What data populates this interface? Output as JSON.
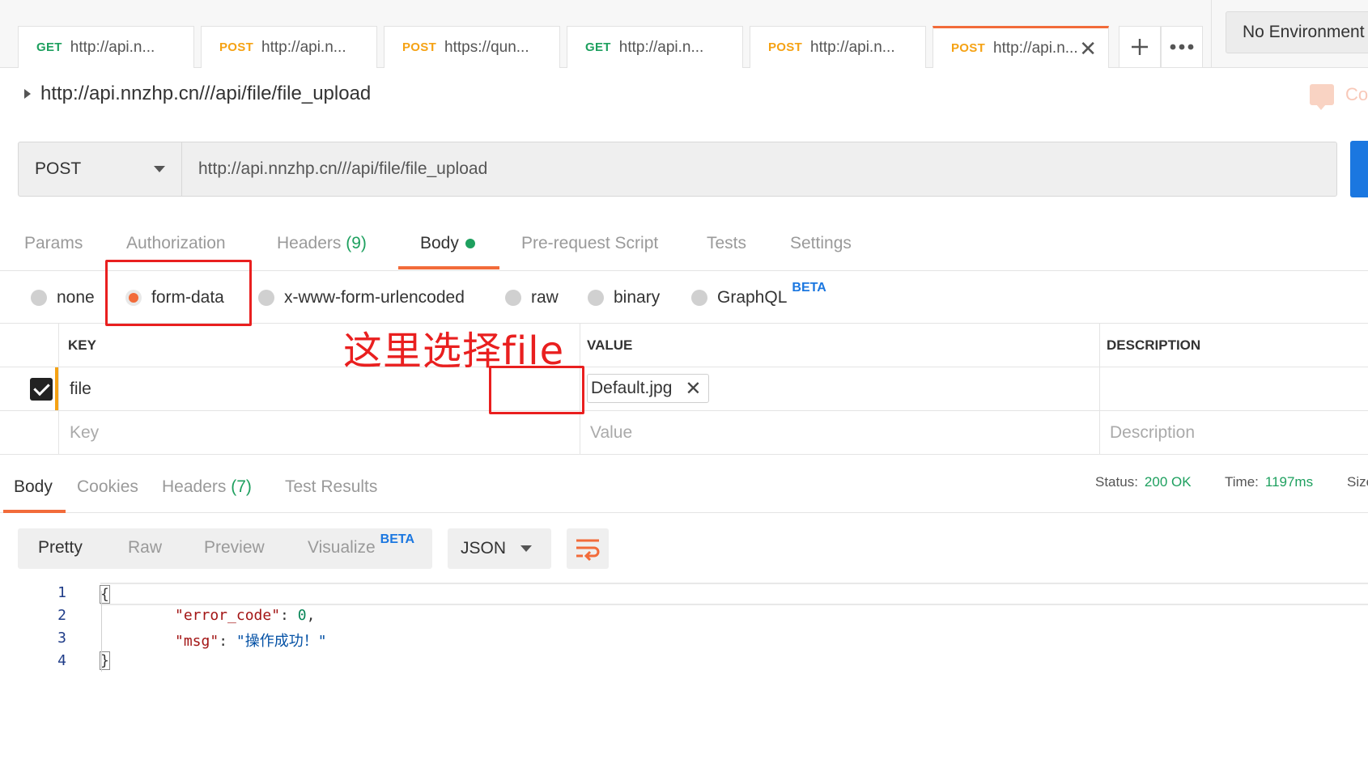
{
  "tabs": [
    {
      "method": "GET",
      "url": "http://api.n...",
      "active": false
    },
    {
      "method": "POST",
      "url": "http://api.n...",
      "active": false
    },
    {
      "method": "POST",
      "url": "https://qun...",
      "active": false
    },
    {
      "method": "GET",
      "url": "http://api.n...",
      "active": false
    },
    {
      "method": "POST",
      "url": "http://api.n...",
      "active": false
    },
    {
      "method": "POST",
      "url": "http://api.n...",
      "active": true
    }
  ],
  "tab_actions": {
    "add_icon": "plus-icon",
    "more_icon": "ellipsis-icon",
    "close_glyph": "✕"
  },
  "environment": "No Environment",
  "request": {
    "title": "http://api.nnzhp.cn///api/file/file_upload",
    "method": "POST",
    "url": "http://api.nnzhp.cn///api/file/file_upload",
    "comments_label": "Comments"
  },
  "request_tabs": {
    "params": "Params",
    "authorization": "Authorization",
    "headers": "Headers",
    "headers_count": "(9)",
    "body": "Body",
    "prerequest": "Pre-request Script",
    "tests": "Tests",
    "settings": "Settings"
  },
  "body_modes": {
    "none": "none",
    "form_data": "form-data",
    "urlencoded": "x-www-form-urlencoded",
    "raw": "raw",
    "binary": "binary",
    "graphql": "GraphQL",
    "beta": "BETA",
    "selected": "form-data"
  },
  "annotation": "这里选择file",
  "params_table": {
    "headers": {
      "key": "KEY",
      "value": "VALUE",
      "description": "DESCRIPTION"
    },
    "rows": [
      {
        "checked": true,
        "key": "file",
        "value": "Default.jpg",
        "description": ""
      }
    ],
    "placeholders": {
      "key": "Key",
      "value": "Value",
      "description": "Description"
    }
  },
  "response": {
    "tabs": {
      "body": "Body",
      "cookies": "Cookies",
      "headers": "Headers",
      "headers_count": "(7)",
      "test_results": "Test Results"
    },
    "status_label": "Status:",
    "status_value": "200 OK",
    "time_label": "Time:",
    "time_value": "1197ms",
    "size_label": "Size:",
    "views": {
      "pretty": "Pretty",
      "raw": "Raw",
      "preview": "Preview",
      "visualize": "Visualize",
      "beta": "BETA"
    },
    "format": "JSON",
    "wrap_icon": "wrap-lines-icon",
    "code_lines": [
      {
        "n": "1",
        "open": "{"
      },
      {
        "n": "2",
        "key": "\"error_code\"",
        "sep": ": ",
        "num": "0",
        "tail": ","
      },
      {
        "n": "3",
        "key": "\"msg\"",
        "sep": ": ",
        "str": "\"操作成功！\""
      },
      {
        "n": "4",
        "close": "}"
      }
    ]
  },
  "colors": {
    "accent": "#f26b3a",
    "get": "#1ea05f",
    "post": "#f5a214",
    "annotation": "#e91f1f",
    "send": "#1b77e0"
  }
}
